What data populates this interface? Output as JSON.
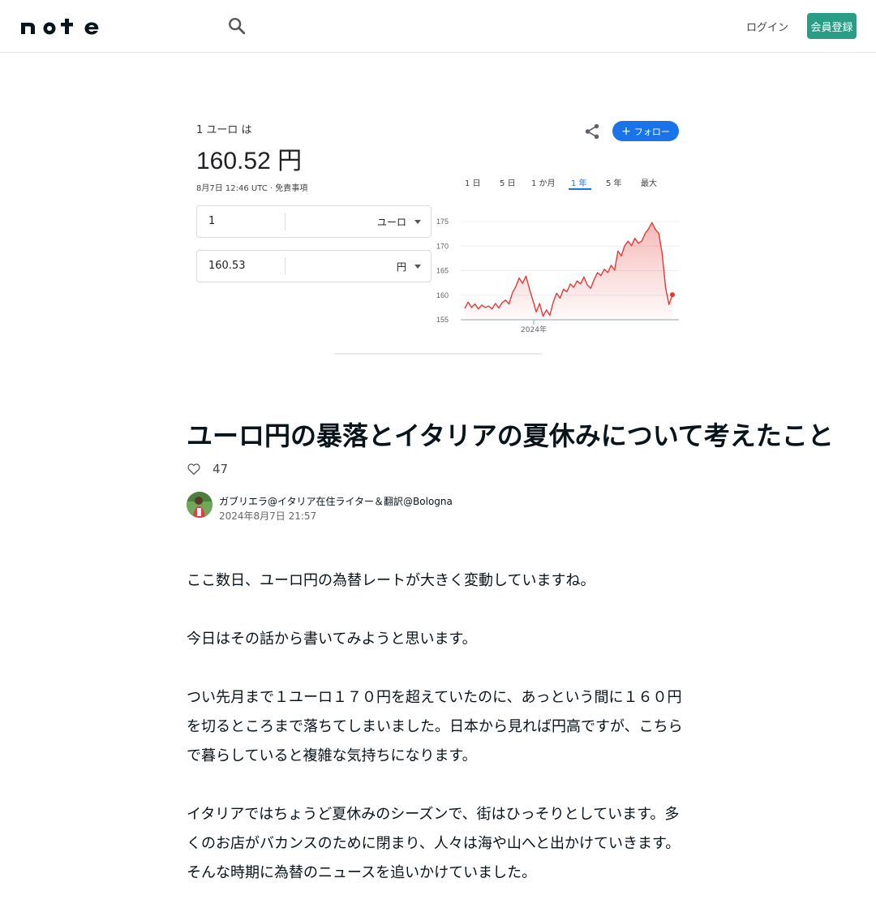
{
  "header": {
    "logo_text": "note",
    "search_icon": "search-icon",
    "login_label": "ログイン",
    "signup_label": "会員登録"
  },
  "eyecatch": {
    "amount_label": "1 ユーロ は",
    "rate": "160.52 円",
    "date_note": "8月7日 12:46 UTC · 免責事項",
    "follow_label": "フォロー",
    "input_from": {
      "value": "1",
      "currency": "ユーロ"
    },
    "input_to": {
      "value": "160.53",
      "currency": "円"
    },
    "tabs": [
      "1 日",
      "5 日",
      "1 か月",
      "1 年",
      "5 年",
      "最大"
    ],
    "active_tab": "1 年",
    "colors": {
      "accent": "#1a73e8",
      "line": "#e53935"
    }
  },
  "chart_data": {
    "type": "area",
    "title": "",
    "xlabel": "",
    "ylabel": "",
    "x_tick_labels": [
      "2024年"
    ],
    "y_ticks": [
      155,
      160,
      165,
      170,
      175
    ],
    "ylim": [
      155,
      176
    ],
    "series": [
      {
        "values": [
          157.3,
          158.6,
          157.5,
          158.2,
          157.2,
          158.0,
          157.5,
          157.8,
          157.2,
          158.3,
          157.4,
          158.5,
          159.0,
          158.2,
          160.5,
          161.8,
          163.5,
          162.4,
          163.9,
          161.3,
          159.0,
          156.6,
          158.3,
          155.7,
          157.0,
          155.9,
          158.6,
          160.4,
          159.4,
          161.2,
          160.7,
          162.3,
          161.6,
          162.9,
          162.3,
          163.7,
          162.1,
          161.4,
          163.2,
          164.6,
          164.0,
          165.3,
          164.6,
          166.1,
          165.1,
          169.0,
          168.0,
          170.1,
          171.0,
          170.1,
          171.6,
          170.6,
          171.0,
          172.6,
          173.5,
          174.8,
          173.4,
          172.6,
          168.5,
          161.5,
          158.1,
          160.1
        ]
      }
    ],
    "grid": true,
    "line_color": "#e53935"
  },
  "article": {
    "title": "ユーロ円の暴落とイタリアの夏休みについて考えたこと",
    "likes": "47",
    "author_name": "ガブリエラ@イタリア在住ライター＆翻訳@Bologna",
    "post_date": "2024年8月7日 21:57",
    "paragraphs": [
      "ここ数日、ユーロ円の為替レートが大きく変動していますね。",
      "今日はその話から書いてみようと思います。",
      "つい先月まで１ユーロ１７０円を超えていたのに、あっという間に１６０円を切るところまで落ちてしまいました。日本から見れば円高ですが、こちらで暮らしていると複雑な気持ちになります。",
      "イタリアではちょうど夏休みのシーズンで、街はひっそりとしています。多くのお店がバカンスのために閉まり、人々は海や山へと出かけていきます。そんな時期に為替のニュースを追いかけていました。"
    ]
  }
}
